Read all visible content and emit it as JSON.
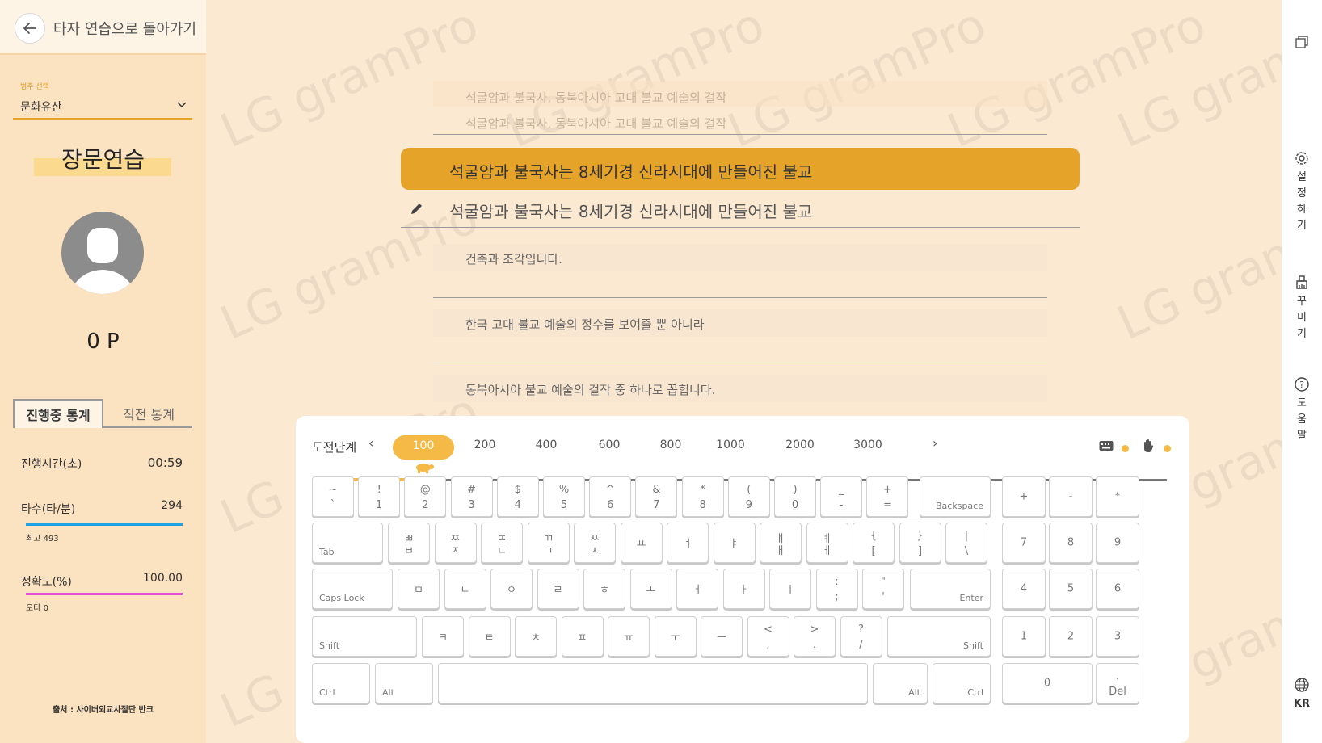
{
  "sidebar": {
    "back_label": "타자 연습으로 돌아가기",
    "category_small_label": "범주 선택",
    "category_value": "문화유산",
    "mode_title": "장문연습",
    "points": "0 P",
    "tab_current": "진행중 통계",
    "tab_previous": "직전 통계",
    "stats": {
      "time_label": "진행시간(초)",
      "time_value": "00:59",
      "speed_label": "타수(타/분)",
      "speed_value": "294",
      "speed_best": "최고 493",
      "speed_color": "#1fa3e3",
      "accuracy_label": "정확도(%)",
      "accuracy_value": "100.00",
      "typos": "오타 0",
      "accuracy_color": "#e24fd6"
    },
    "source": "출처 : 사이버외교사절단 반크"
  },
  "watermark": "LG gramPro",
  "practice": {
    "done_1": "석굴암과 불국사, 동북아시아 고대 불교 예술의 걸작",
    "done_2": "석굴암과 불국사, 동북아시아 고대 불교 예술의 걸작",
    "target": "석굴암과 불국사는 8세기경 신라시대에 만들어진 불교",
    "typed": "석굴암과 불국사는 8세기경 신라시대에 만들어진 불교",
    "next_1": "건축과 조각입니다.",
    "next_2": "한국 고대 불교 예술의 정수를 보여줄 뿐 아니라",
    "next_3": "동북아시아 불교 예술의 걸작 중 하나로 꼽힙니다.",
    "accent_color": "#e5a32a"
  },
  "challenge": {
    "title": "도전단계",
    "prev": "‹",
    "next": "›",
    "stages": [
      "100",
      "200",
      "400",
      "600",
      "800",
      "1000",
      "2000",
      "3000"
    ],
    "active_stage": "100",
    "progress": 0.125
  },
  "keyboard": {
    "row1": [
      {
        "top": "~",
        "bot": "`"
      },
      {
        "top": "!",
        "bot": "1"
      },
      {
        "top": "@",
        "bot": "2"
      },
      {
        "top": "#",
        "bot": "3"
      },
      {
        "top": "$",
        "bot": "4"
      },
      {
        "top": "%",
        "bot": "5"
      },
      {
        "top": "^",
        "bot": "6"
      },
      {
        "top": "&",
        "bot": "7"
      },
      {
        "top": "*",
        "bot": "8"
      },
      {
        "top": "(",
        "bot": "9"
      },
      {
        "top": ")",
        "bot": "0"
      },
      {
        "top": "_",
        "bot": "-"
      },
      {
        "top": "+",
        "bot": "="
      }
    ],
    "backspace": "Backspace",
    "tab": "Tab",
    "row2": [
      {
        "top": "ㅃ",
        "bot": "ㅂ"
      },
      {
        "top": "ㅉ",
        "bot": "ㅈ"
      },
      {
        "top": "ㄸ",
        "bot": "ㄷ"
      },
      {
        "top": "ㄲ",
        "bot": "ㄱ"
      },
      {
        "top": "ㅆ",
        "bot": "ㅅ"
      },
      {
        "top": "",
        "bot": "ㅛ"
      },
      {
        "top": "",
        "bot": "ㅕ"
      },
      {
        "top": "",
        "bot": "ㅑ"
      },
      {
        "top": "ㅒ",
        "bot": "ㅐ"
      },
      {
        "top": "ㅖ",
        "bot": "ㅔ"
      },
      {
        "top": "{",
        "bot": "["
      },
      {
        "top": "}",
        "bot": "]"
      },
      {
        "top": "|",
        "bot": "\\"
      }
    ],
    "caps": "Caps Lock",
    "row3": [
      {
        "top": "",
        "bot": "ㅁ"
      },
      {
        "top": "",
        "bot": "ㄴ"
      },
      {
        "top": "",
        "bot": "ㅇ"
      },
      {
        "top": "",
        "bot": "ㄹ"
      },
      {
        "top": "",
        "bot": "ㅎ"
      },
      {
        "top": "",
        "bot": "ㅗ"
      },
      {
        "top": "",
        "bot": "ㅓ"
      },
      {
        "top": "",
        "bot": "ㅏ"
      },
      {
        "top": "",
        "bot": "ㅣ"
      },
      {
        "top": ":",
        "bot": ";"
      },
      {
        "top": "\"",
        "bot": "'"
      }
    ],
    "enter": "Enter",
    "shift_left": "Shift",
    "row4": [
      {
        "top": "",
        "bot": "ㅋ"
      },
      {
        "top": "",
        "bot": "ㅌ"
      },
      {
        "top": "",
        "bot": "ㅊ"
      },
      {
        "top": "",
        "bot": "ㅍ"
      },
      {
        "top": "",
        "bot": "ㅠ"
      },
      {
        "top": "",
        "bot": "ㅜ"
      },
      {
        "top": "",
        "bot": "ㅡ"
      },
      {
        "top": "<",
        "bot": ","
      },
      {
        "top": ">",
        "bot": "."
      },
      {
        "top": "?",
        "bot": "/"
      }
    ],
    "shift_right": "Shift",
    "ctrl_left": "Ctrl",
    "alt_left": "Alt",
    "alt_right": "Alt",
    "ctrl_right": "Ctrl",
    "numpad": [
      [
        "+",
        "-",
        "*"
      ],
      [
        "7",
        "8",
        "9"
      ],
      [
        "4",
        "5",
        "6"
      ],
      [
        "1",
        "2",
        "3"
      ]
    ],
    "num0": "0",
    "del_top": ".",
    "del": "Del"
  },
  "rail": {
    "settings": "설정하기",
    "decorate": "꾸미기",
    "help": "도움말",
    "lang": "KR"
  },
  "icons": [
    "back-arrow-icon",
    "chevron-down-icon",
    "avatar-icon",
    "pencil-icon",
    "turtle-icon",
    "keyboard-icon",
    "hand-icon",
    "window-icon",
    "gear-icon",
    "brush-icon",
    "help-icon",
    "globe-icon"
  ]
}
